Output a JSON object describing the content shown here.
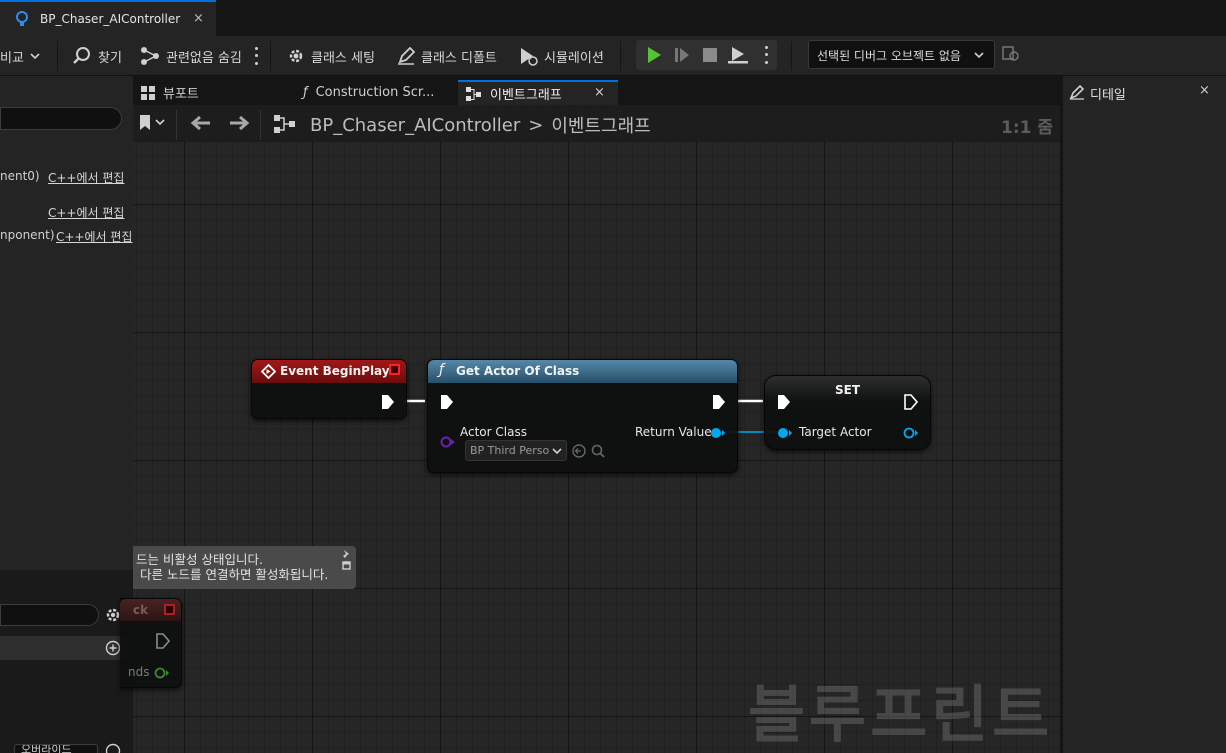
{
  "document_tab": {
    "title": "BP_Chaser_AIController",
    "close": "×"
  },
  "toolbar": {
    "diff_label": "비교",
    "find_label": "찾기",
    "hide_unrelated_label": "관련없음 숨김",
    "class_settings_label": "클래스 세팅",
    "class_defaults_label": "클래스 디폴트",
    "simulation_label": "시뮬레이션",
    "debug_object_label": "선택된 디버그 오브젝트 없음"
  },
  "center_tabs": [
    {
      "label": "뷰포트"
    },
    {
      "label": "Construction Scr..."
    },
    {
      "label": "이벤트그래프",
      "close": "×"
    }
  ],
  "breadcrumb": {
    "root": "BP_Chaser_AIController",
    "separator": ">",
    "current": "이벤트그래프"
  },
  "zoom": "1:1 줌",
  "watermark": "블루프린트",
  "left_panel": {
    "components": [
      {
        "name": "nent0)",
        "action": "C++에서 편집"
      },
      {
        "name": "",
        "action": "C++에서 편집"
      },
      {
        "name": "nponent)",
        "action": "C++에서 편집"
      }
    ],
    "partial_node_title": "ck",
    "partial_node_pin": "nds",
    "bottom_select": "오버라이드"
  },
  "right_panel": {
    "tab_label": "디테일",
    "close": "×"
  },
  "disabled_note": {
    "line1": "드는 비활성 상태입니다.",
    "line2": "다른 노드를 연결하면 활성화됩니다."
  },
  "nodes": {
    "event_begin_play": {
      "title": "Event BeginPlay",
      "head_color": "#8e1010"
    },
    "get_actor_of_class": {
      "title": "Get Actor Of Class",
      "head_color": "#3b6a86",
      "actor_class_label": "Actor Class",
      "actor_class_value": "BP Third Perso",
      "return_value_label": "Return Value"
    },
    "set_node": {
      "title": "SET",
      "target_label": "Target Actor"
    }
  },
  "colors": {
    "accent": "#0070e0",
    "object_pin": "#00a8f0",
    "class_pin": "#6c1fb5",
    "play_green": "#59c234"
  }
}
